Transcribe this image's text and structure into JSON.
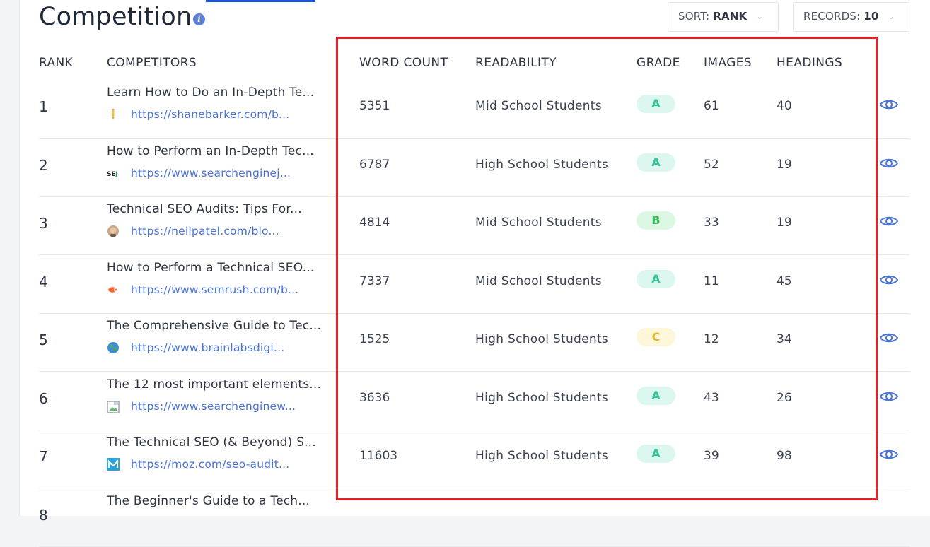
{
  "header": {
    "title": "Competition",
    "info_icon": "info-icon",
    "sort": {
      "label": "SORT:",
      "value": "RANK"
    },
    "records": {
      "label": "RECORDS:",
      "value": "10"
    }
  },
  "columns": {
    "rank": "RANK",
    "competitors": "COMPETITORS",
    "word_count": "WORD COUNT",
    "readability": "READABILITY",
    "grade": "GRADE",
    "images": "IMAGES",
    "headings": "HEADINGS"
  },
  "rows": [
    {
      "rank": "1",
      "title": "Learn How to Do an In-Depth Te...",
      "url": "https://shanebarker.com/b...",
      "favicon": "pencil-icon",
      "word_count": "5351",
      "readability": "Mid School Students",
      "grade": "A",
      "images": "61",
      "headings": "40"
    },
    {
      "rank": "2",
      "title": "How to Perform an In-Depth Tec...",
      "url": "https://www.searchenginej...",
      "favicon": "sej-logo-icon",
      "word_count": "6787",
      "readability": "High School Students",
      "grade": "A",
      "images": "52",
      "headings": "19"
    },
    {
      "rank": "3",
      "title": "Technical SEO Audits: Tips For...",
      "url": "https://neilpatel.com/blo...",
      "favicon": "avatar-face-icon",
      "word_count": "4814",
      "readability": "Mid School Students",
      "grade": "B",
      "images": "33",
      "headings": "19"
    },
    {
      "rank": "4",
      "title": "How to Perform a Technical SEO...",
      "url": "https://www.semrush.com/b...",
      "favicon": "semrush-logo-icon",
      "word_count": "7337",
      "readability": "Mid School Students",
      "grade": "A",
      "images": "11",
      "headings": "45"
    },
    {
      "rank": "5",
      "title": "The Comprehensive Guide to Tec...",
      "url": "https://www.brainlabsdigi...",
      "favicon": "globe-icon",
      "word_count": "1525",
      "readability": "High School Students",
      "grade": "C",
      "images": "12",
      "headings": "34"
    },
    {
      "rank": "6",
      "title": "The 12 most important elements...",
      "url": "https://www.searchenginew...",
      "favicon": "broken-image-icon",
      "word_count": "3636",
      "readability": "High School Students",
      "grade": "A",
      "images": "43",
      "headings": "26"
    },
    {
      "rank": "7",
      "title": "The Technical SEO (& Beyond) S...",
      "url": "https://moz.com/seo-audit...",
      "favicon": "moz-logo-icon",
      "word_count": "11603",
      "readability": "High School Students",
      "grade": "A",
      "images": "39",
      "headings": "98"
    },
    {
      "rank": "8",
      "title": "The Beginner's Guide to a Tech...",
      "url": "",
      "favicon": "",
      "word_count": "",
      "readability": "",
      "grade": "",
      "images": "",
      "headings": ""
    }
  ],
  "colors": {
    "accent": "#1a56db",
    "link": "#4a73d8",
    "highlight_border": "#ec1c24",
    "grade_a": "#33c39d",
    "grade_b": "#3dbb5b",
    "grade_c": "#dbb62c"
  }
}
